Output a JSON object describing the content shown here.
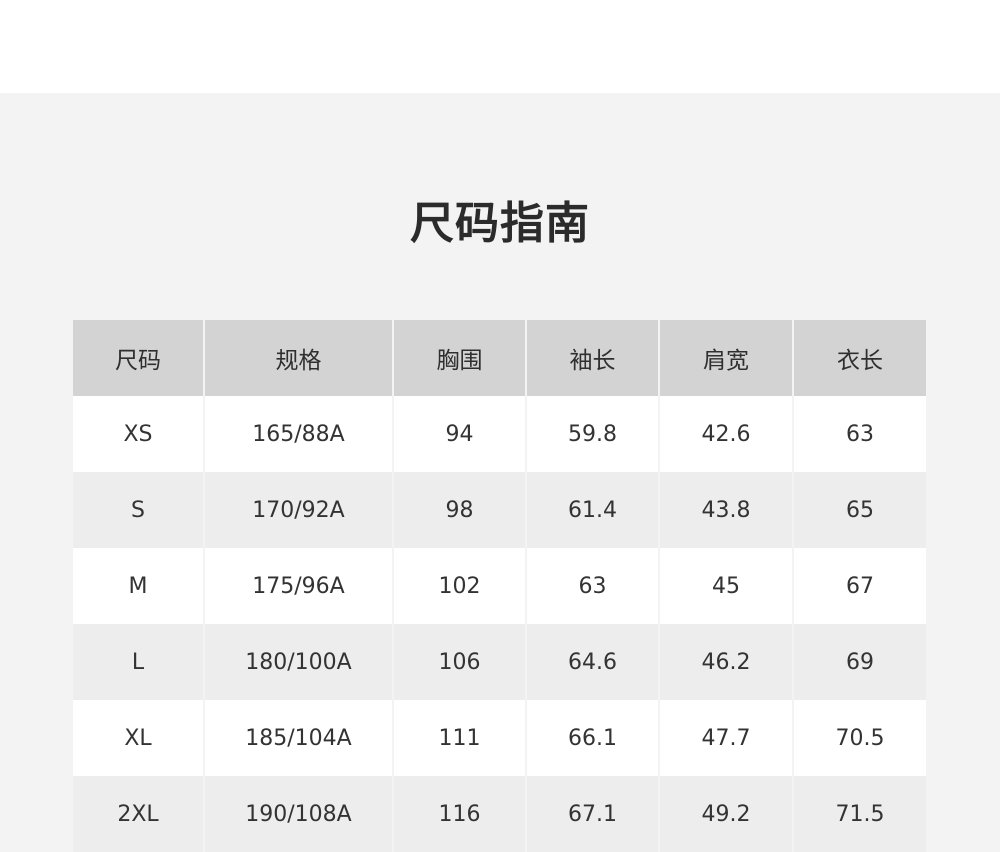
{
  "page": {
    "title": "尺码指南"
  },
  "table": {
    "headers": [
      "尺码",
      "规格",
      "胸围",
      "袖长",
      "肩宽",
      "衣长"
    ],
    "rows": [
      [
        "XS",
        "165/88A",
        "94",
        "59.8",
        "42.6",
        "63"
      ],
      [
        "S",
        "170/92A",
        "98",
        "61.4",
        "43.8",
        "65"
      ],
      [
        "M",
        "175/96A",
        "102",
        "63",
        "45",
        "67"
      ],
      [
        "L",
        "180/100A",
        "106",
        "64.6",
        "46.2",
        "69"
      ],
      [
        "XL",
        "185/104A",
        "111",
        "66.1",
        "47.7",
        "70.5"
      ],
      [
        "2XL",
        "190/108A",
        "116",
        "67.1",
        "49.2",
        "71.5"
      ]
    ]
  },
  "colors": {
    "background": "#f3f3f3",
    "header_bg": "#d3d3d3",
    "row_white": "#ffffff",
    "row_gray": "#ededed",
    "text": "#333333"
  }
}
